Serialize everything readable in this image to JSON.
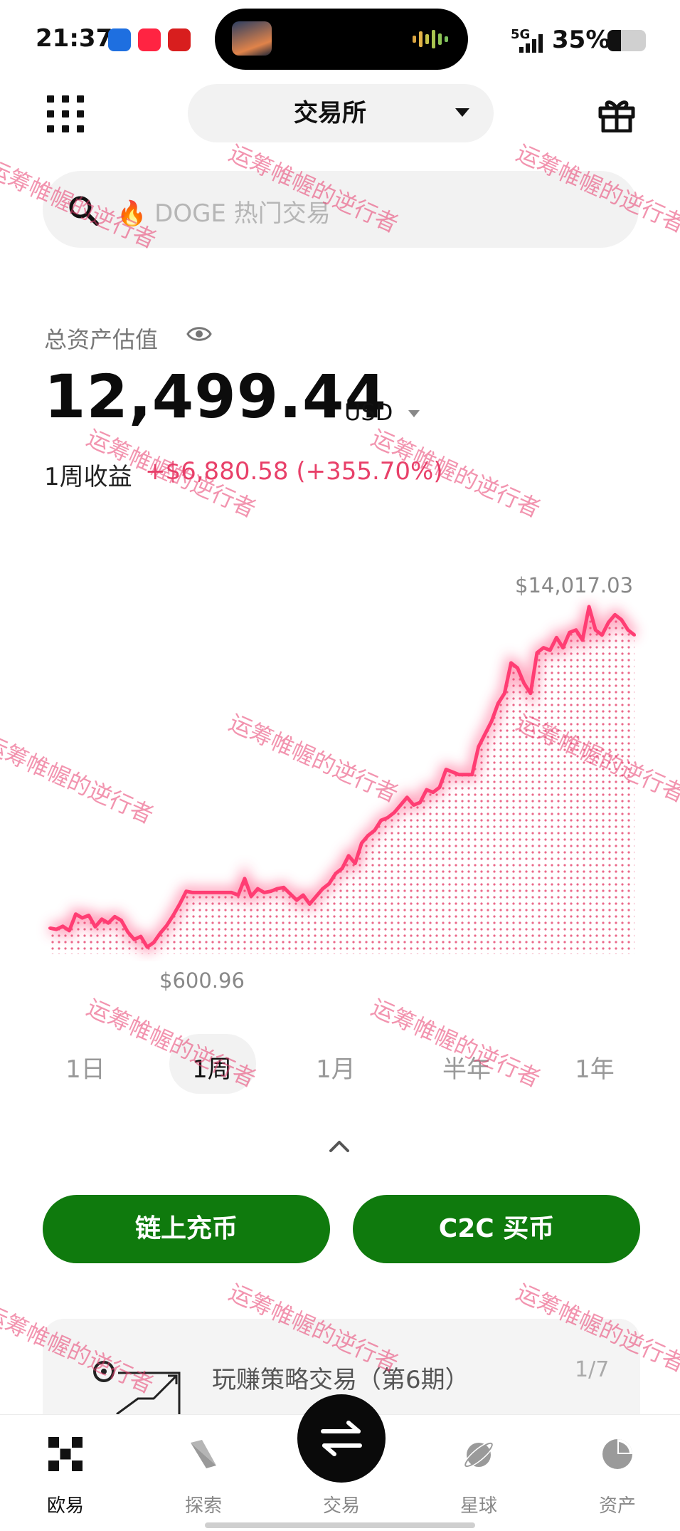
{
  "status_bar": {
    "time": "21:37",
    "network": "5G",
    "battery_percent": "35%",
    "battery_level": 0.35
  },
  "header": {
    "menu_icon": "grid-icon",
    "title": "交易所",
    "gift_icon": "gift-icon"
  },
  "search": {
    "placeholder": "🔥 DOGE 热门交易"
  },
  "assets": {
    "label": "总资产估值",
    "value": "12,499.44",
    "currency": "USD",
    "period_label": "1周收益",
    "period_profit": "+$6,880.58 (+355.70%)"
  },
  "chart_data": {
    "type": "area",
    "max_label": "$14,017.03",
    "min_label": "$600.96",
    "color": "#ff3d73",
    "y": [
      1350,
      1300,
      1420,
      1250,
      1900,
      1750,
      1850,
      1400,
      1700,
      1550,
      1800,
      1650,
      1200,
      900,
      1020,
      600.96,
      780,
      1150,
      1450,
      1850,
      2300,
      2800,
      2750,
      2750,
      2750,
      2750,
      2750,
      2750,
      2750,
      2650,
      3300,
      2600,
      2900,
      2750,
      2800,
      2900,
      2950,
      2700,
      2450,
      2650,
      2300,
      2600,
      2900,
      3100,
      3500,
      3700,
      4200,
      3900,
      4700,
      5000,
      5200,
      5600,
      5700,
      5900,
      6200,
      6500,
      6200,
      6300,
      6800,
      6700,
      6900,
      7600,
      7500,
      7400,
      7400,
      7400,
      8500,
      9000,
      9500,
      10200,
      10600,
      11800,
      11600,
      11000,
      10600,
      12200,
      12400,
      12300,
      12800,
      12400,
      13000,
      13100,
      12700,
      14017.03,
      13100,
      12900,
      13400,
      13700,
      13500,
      13100,
      12900
    ]
  },
  "periods": [
    "1日",
    "1周",
    "1月",
    "半年",
    "1年"
  ],
  "active_period": "1周",
  "actions": {
    "deposit": "链上充币",
    "buy": "C2C 买币"
  },
  "promo": {
    "title": "玩赚策略交易（第6期）",
    "counter": "1/7"
  },
  "watermark": "运筹帷幄的逆行者",
  "nav": {
    "items": [
      {
        "label": "欧易",
        "icon": "okx-logo-icon"
      },
      {
        "label": "探索",
        "icon": "compass-icon"
      },
      {
        "label": "交易",
        "icon": "swap-icon"
      },
      {
        "label": "星球",
        "icon": "planet-icon"
      },
      {
        "label": "资产",
        "icon": "pie-chart-icon"
      }
    ],
    "active": "欧易"
  },
  "colors": {
    "accent_green": "#0f7a0d",
    "profit_pink": "#e84069",
    "chart_line": "#ff3d73"
  }
}
